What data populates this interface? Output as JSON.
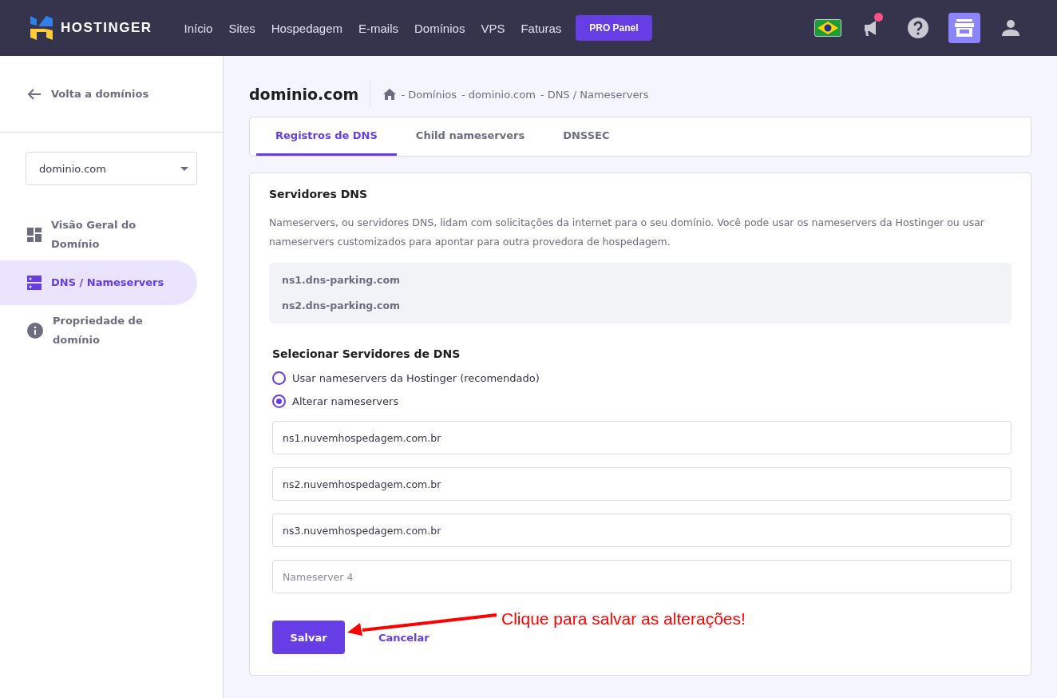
{
  "header": {
    "logo": "HOSTINGER",
    "nav": [
      "Início",
      "Sites",
      "Hospedagem",
      "E-mails",
      "Domínios",
      "VPS",
      "Faturas"
    ],
    "pro_button": "PRO Panel",
    "notification_badge": true
  },
  "sidebar": {
    "back_link": "Volta a domínios",
    "domain_select": {
      "value": "dominio.com"
    },
    "items": [
      {
        "kind": "overview",
        "label": "Visão Geral do Domínio",
        "selected": false
      },
      {
        "kind": "dns",
        "label": "DNS / Nameservers",
        "selected": true
      },
      {
        "kind": "info",
        "label": "Propriedade de domínio",
        "selected": false
      }
    ]
  },
  "page": {
    "title": "dominio.com",
    "breadcrumb": [
      "- Domínios",
      "- dominio.com",
      "- DNS / Nameservers"
    ]
  },
  "tabs": [
    {
      "label": "Registros de DNS",
      "selected": true
    },
    {
      "label": "Child nameservers",
      "selected": false
    },
    {
      "label": "DNSSEC",
      "selected": false
    }
  ],
  "dns_card": {
    "title": "Servidores DNS",
    "description": "Nameservers, ou servidores DNS, lidam com solicitações da internet para o seu domínio. Você pode usar os nameservers da Hostinger ou usar nameservers customizados para apontar para outra provedora de hospedagem.",
    "current": [
      "ns1.dns-parking.com",
      "ns2.dns-parking.com"
    ],
    "select_title": "Selecionar Servidores de DNS",
    "options": [
      {
        "label": "Usar nameservers da Hostinger (recomendado)",
        "selected": false
      },
      {
        "label": "Alterar nameservers",
        "selected": true
      }
    ],
    "fields": [
      {
        "value": "ns1.nuvemhospedagem.com.br"
      },
      {
        "value": "ns2.nuvemhospedagem.com.br"
      },
      {
        "value": "ns3.nuvemhospedagem.com.br"
      },
      {
        "placeholder": "Nameserver 4"
      }
    ],
    "save": "Salvar",
    "cancel": "Cancelar"
  },
  "annotation": {
    "text": "Clique para salvar as alterações!"
  }
}
